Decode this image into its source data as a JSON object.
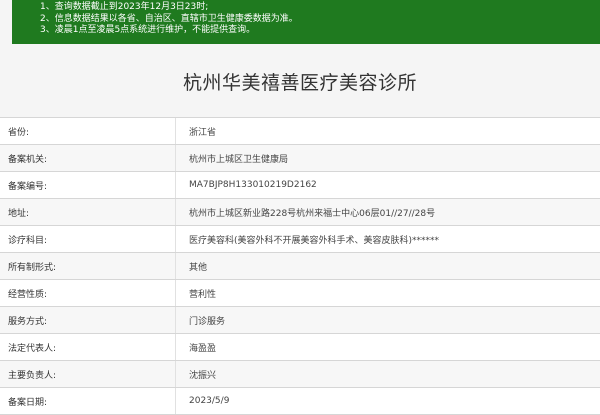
{
  "notice": {
    "lines": [
      "1、查询数据截止到2023年12月3日23时;",
      "2、信息数据结果以各省、自治区、直辖市卫生健康委数据为准。",
      "3、凌晨1点至凌晨5点系统进行维护，不能提供查询。"
    ]
  },
  "page_title": "杭州华美禧善医疗美容诊所",
  "fields": [
    {
      "label": "省份:",
      "value": "浙江省"
    },
    {
      "label": "备案机关:",
      "value": "杭州市上城区卫生健康局"
    },
    {
      "label": "备案编号:",
      "value": "MA7BJP8H133010219D2162"
    },
    {
      "label": "地址:",
      "value": "杭州市上城区新业路228号杭州来福士中心06层01//27//28号"
    },
    {
      "label": "诊疗科目:",
      "value": "医疗美容科(美容外科不开展美容外科手术、美容皮肤科)******"
    },
    {
      "label": "所有制形式:",
      "value": "其他"
    },
    {
      "label": "经营性质:",
      "value": "营利性"
    },
    {
      "label": "服务方式:",
      "value": "门诊服务"
    },
    {
      "label": "法定代表人:",
      "value": "海盈盈"
    },
    {
      "label": "主要负责人:",
      "value": "沈振兴"
    },
    {
      "label": "备案日期:",
      "value": "2023/5/9"
    }
  ]
}
